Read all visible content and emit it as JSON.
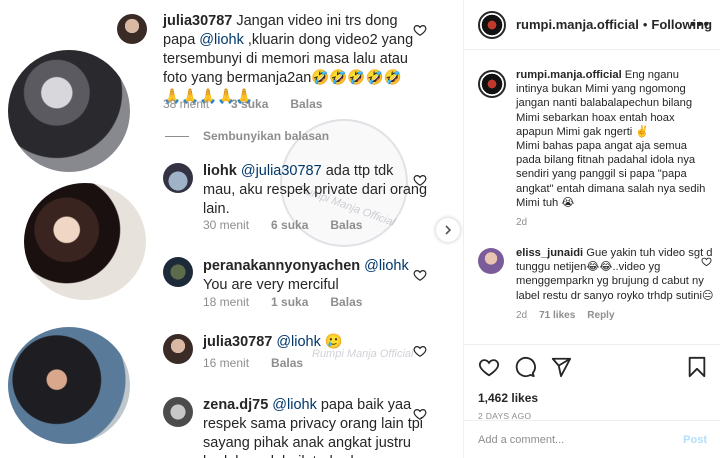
{
  "left_image": {
    "comments": [
      {
        "user": "julia30787",
        "parts": [
          "Jangan video ini trs dong papa ",
          "@liohk",
          " ,kluarin dong video2 yang tersembunyi di memori masa lalu atau foto yang bermanja2an🤣🤣🤣🤣🤣"
        ],
        "emoji_line": "🙏🙏🙏🙏🙏",
        "time": "38 menit",
        "likes": "3 suka",
        "reply": "Balas"
      },
      {
        "user": "liohk",
        "parts": [
          "@julia30787",
          " ada ttp tdk mau, aku respek private dari orang lain."
        ],
        "time": "30 menit",
        "likes": "6 suka",
        "reply": "Balas"
      },
      {
        "user": "peranakannyonyachen",
        "parts": [
          "@liohk",
          " You are very merciful"
        ],
        "time": "18 menit",
        "likes": "1 suka",
        "reply": "Balas"
      },
      {
        "user": "julia30787",
        "parts": [
          "@liohk",
          " 🥲"
        ],
        "time": "16 menit",
        "reply": "Balas"
      },
      {
        "user": "zena.dj75",
        "parts": [
          "@liohk",
          " papa baik yaa respek sama privacy orang lain tpi sayang pihak anak angkat justru berlaku gak baik terhadap"
        ]
      }
    ],
    "hide_replies": "Sembunyikan balasan",
    "watermarks": [
      "Rumpi Manja Official",
      "Rumpi Manja Official"
    ]
  },
  "post": {
    "username": "rumpi.manja.official",
    "follow_status": "Following",
    "caption_user": "rumpi.manja.official",
    "caption_lines": [
      " Eng nganu intinya bukan Mimi yang ngomong jangan nanti balabalapechun bilang Mimi sebarkan hoax entah hoax apapun Mimi gak ngerti ✌️",
      "Mimi bahas papa angat aja semua pada bilang fitnah padahal idola nya sendiri yang panggil si papa \"papa angkat\" entah dimana salah nya sedih Mimi tuh 😭"
    ],
    "caption_time": "2d",
    "comment": {
      "user": "eliss_junaidi",
      "text": " Gue yakin tuh video sgt d tunggu netijen😂😂..video yg menggemparkn yg brujung d cabut ny label restu dr sanyo royko trhdp sutini😑",
      "time": "2d",
      "likes": "71 likes",
      "reply": "Reply"
    },
    "likes": "1,462 likes",
    "posted_ago": "2 DAYS AGO",
    "add_comment_placeholder": "Add a comment...",
    "post_button": "Post"
  },
  "colors": {
    "link": "#00376b",
    "muted": "#8e8e8e",
    "post_disabled": "#b2dffc"
  }
}
